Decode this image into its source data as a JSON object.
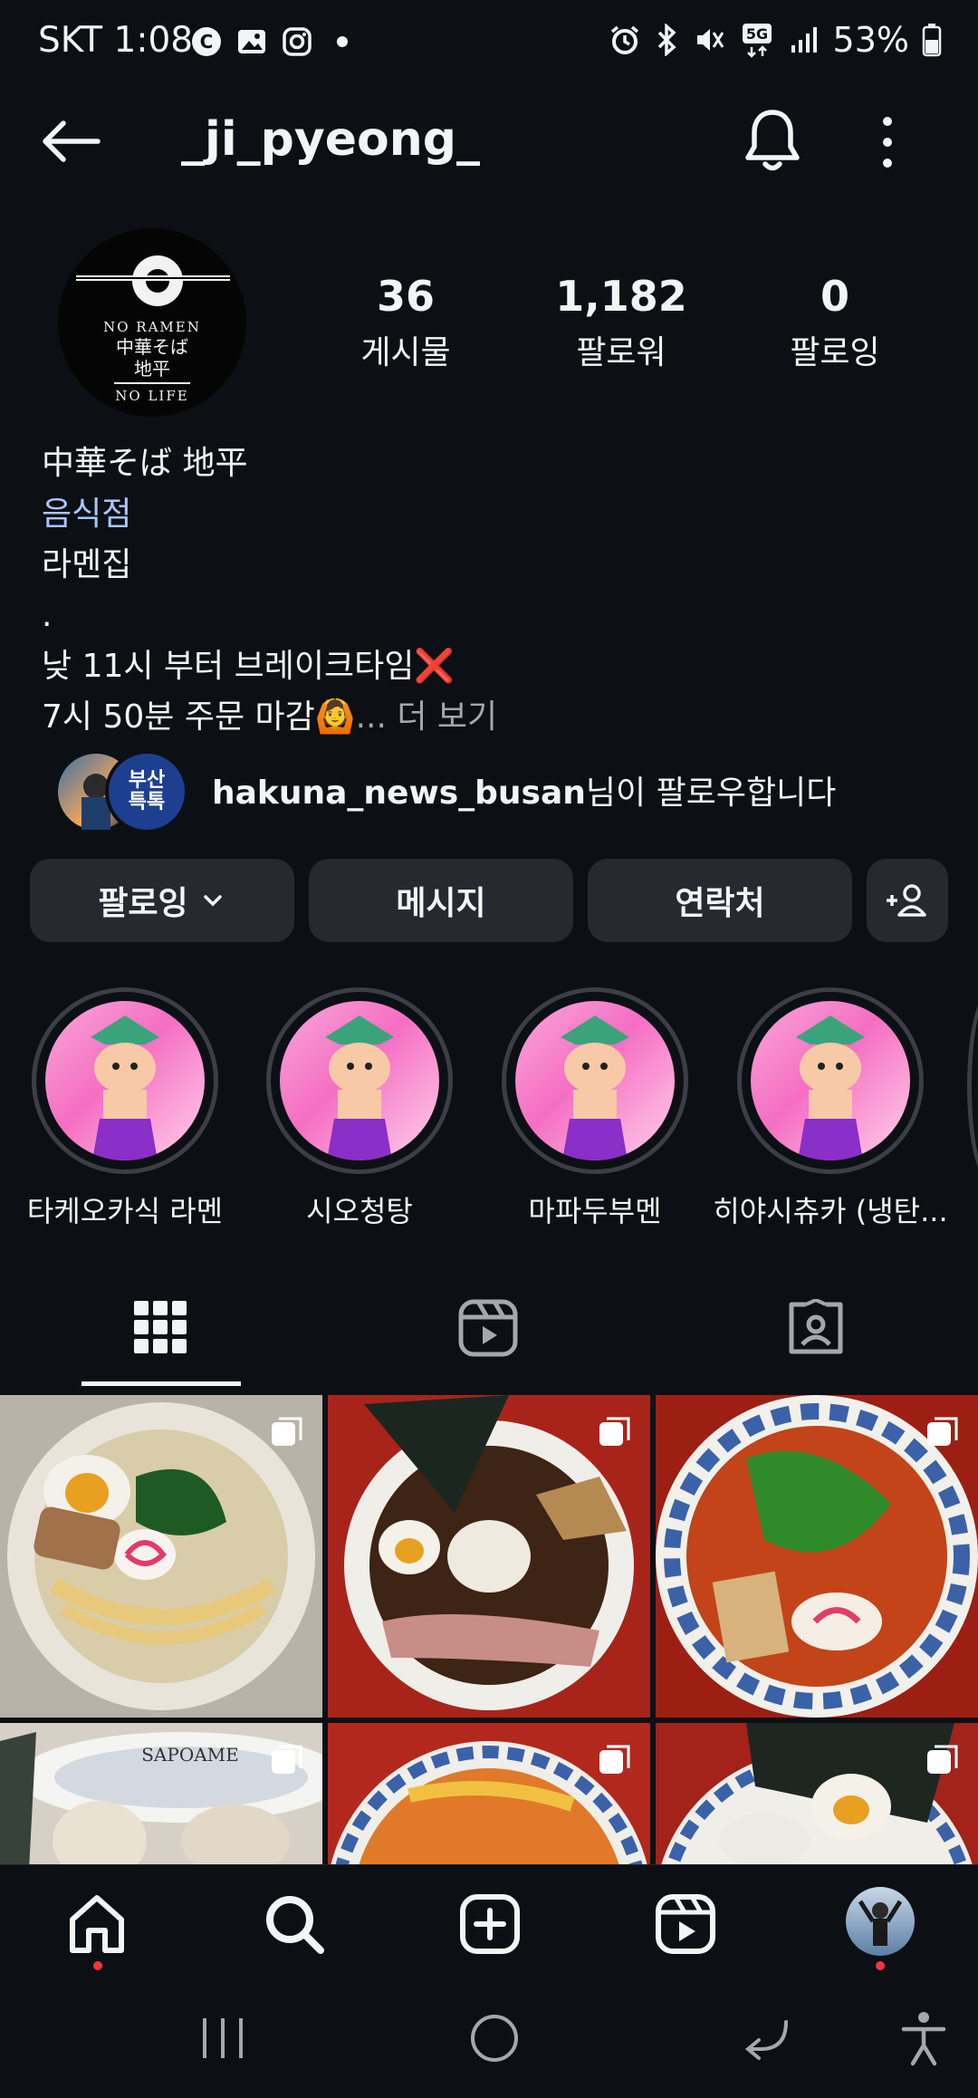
{
  "status_bar": {
    "carrier_time": "SKT 1:08",
    "battery": "53%",
    "icons_left": [
      "c-icon",
      "gallery-icon",
      "instagram-icon",
      "dot-icon"
    ],
    "icons_right": [
      "alarm-icon",
      "bluetooth-icon",
      "mute-icon",
      "5g-icon",
      "signal-icon",
      "battery-icon"
    ]
  },
  "header": {
    "username": "_ji_pyeong_"
  },
  "profile": {
    "logo_text": [
      "NO RAMEN",
      "中華そば",
      "地平",
      "NO LIFE"
    ],
    "stats": [
      {
        "num": "36",
        "label": "게시물"
      },
      {
        "num": "1,182",
        "label": "팔로워"
      },
      {
        "num": "0",
        "label": "팔로잉"
      }
    ],
    "bio": {
      "name": "中華そば 地平",
      "category": "음식점",
      "line1": "라멘집",
      "line2": ".",
      "line3": "낮 11시 부터 브레이크타임❌",
      "line4": "7시 50분 주문 마감🙆",
      "more": "... 더 보기"
    },
    "followed_by": {
      "user": "hakuna_news_busan",
      "suffix": "님이 팔로우합니다",
      "avatar2_text": "부산특톡"
    }
  },
  "buttons": {
    "following": "팔로잉",
    "message": "메시지",
    "contact": "연락처"
  },
  "highlights": [
    {
      "label": "타케오카식 라멘"
    },
    {
      "label": "시오청탕"
    },
    {
      "label": "마파두부멘"
    },
    {
      "label": "히야시츄카 (냉탄..."
    }
  ],
  "grid_watermark": "SAPOAME",
  "colors": {
    "background": "#0c1015",
    "button": "#262a30",
    "link": "#a8c7fa",
    "notification_dot": "#ff3040"
  }
}
